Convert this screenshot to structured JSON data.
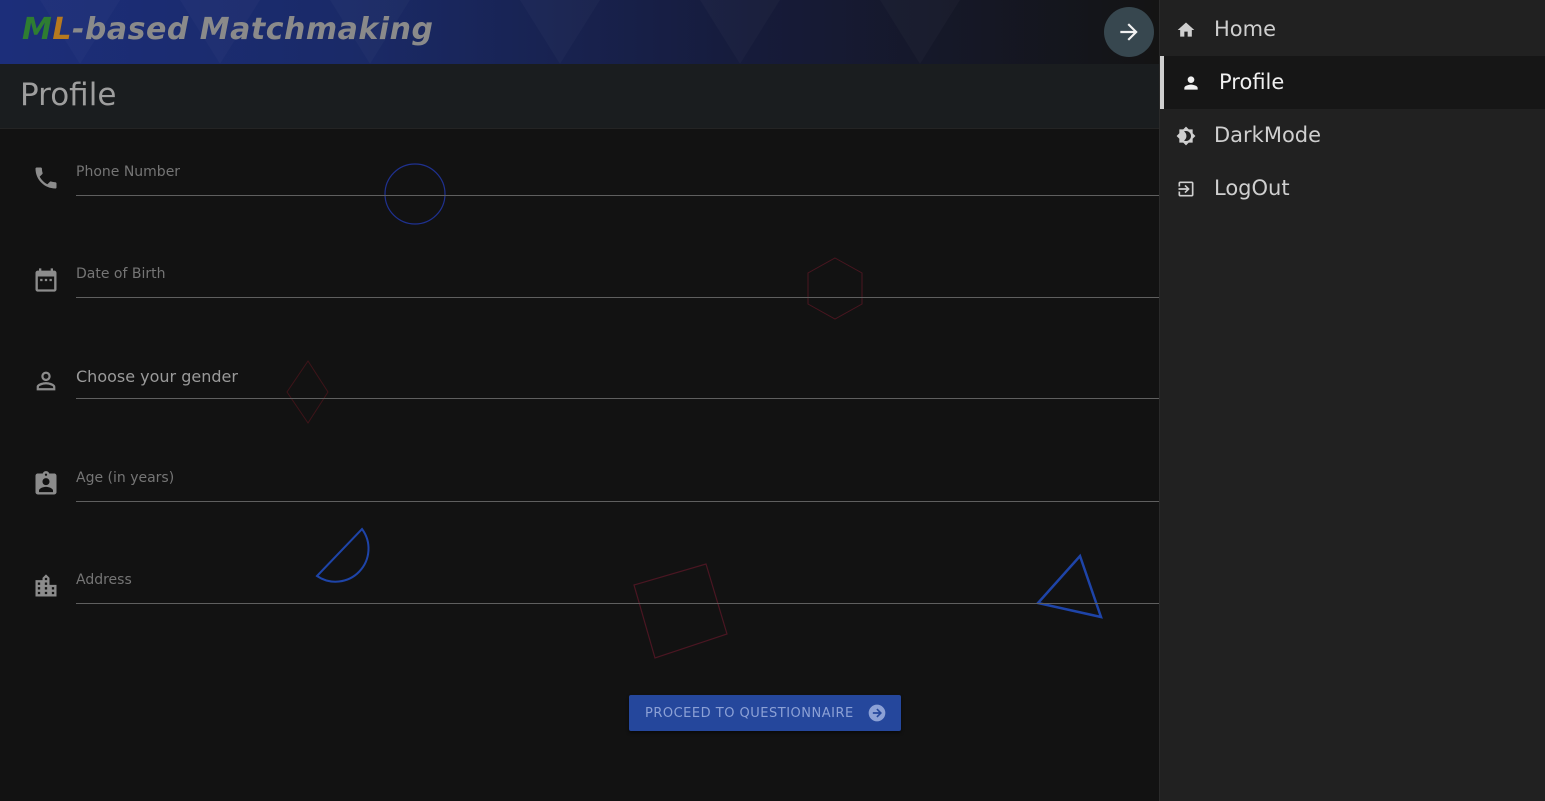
{
  "header": {
    "brand_m": "M",
    "brand_l": "L",
    "brand_rest": "-based Matchmaking",
    "menu_toggle_icon": "arrow-right-icon"
  },
  "page": {
    "title": "Profile"
  },
  "form": {
    "fields": [
      {
        "label": "Phone Number",
        "icon": "phone-icon"
      },
      {
        "label": "Date of Birth",
        "icon": "calendar-icon"
      },
      {
        "label": "Choose your gender",
        "icon": "person-outline-icon"
      },
      {
        "label": "Age (in years)",
        "icon": "contact-card-icon"
      },
      {
        "label": "Address",
        "icon": "city-icon"
      }
    ],
    "proceed_label": "PROCEED TO QUESTIONNAIRE"
  },
  "sidenav": {
    "items": [
      {
        "label": "Home",
        "icon": "home-icon"
      },
      {
        "label": "Profile",
        "icon": "person-icon",
        "active": true
      },
      {
        "label": "DarkMode",
        "icon": "brightness-icon"
      },
      {
        "label": "LogOut",
        "icon": "logout-icon"
      }
    ]
  },
  "colors": {
    "accent": "#25479c",
    "header_gradient_start": "#1c2e7a",
    "background": "#121212",
    "sidenav": "#212121"
  }
}
